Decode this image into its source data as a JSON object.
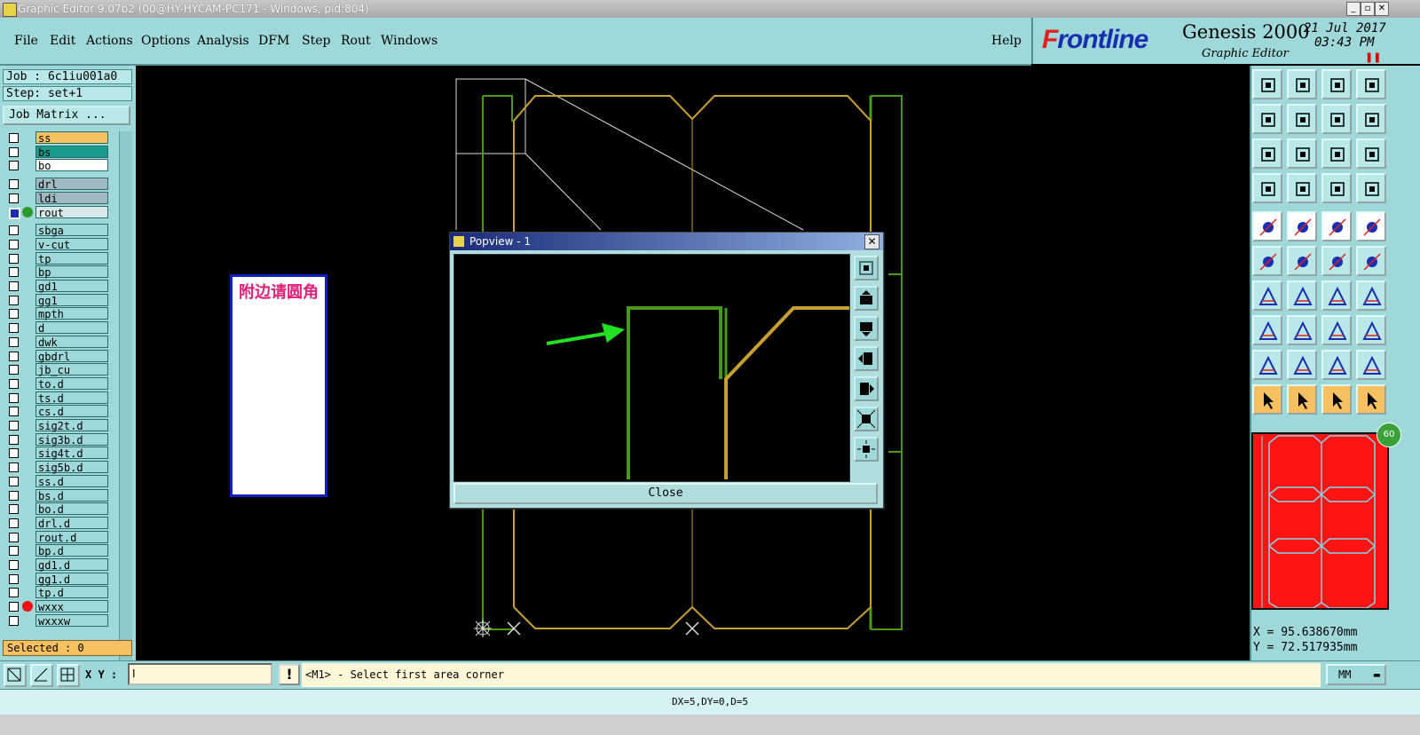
{
  "window": {
    "title": "Graphic Editor 9.07b2 (00@HY-HYCAM-PC171 - Windows, pid:804)"
  },
  "menu": [
    {
      "label": "File"
    },
    {
      "label": "Edit"
    },
    {
      "label": "Actions"
    },
    {
      "label": "Options"
    },
    {
      "label": "Analysis"
    },
    {
      "label": "DFM"
    },
    {
      "label": "Step"
    },
    {
      "label": "Rout"
    },
    {
      "label": "Windows"
    }
  ],
  "help_label": "Help",
  "brand": {
    "logo_prefix": "F",
    "logo_rest": "rontline",
    "product": "Genesis 2000",
    "subtitle": "Graphic Editor",
    "date": "21 Jul 2017",
    "time": "03:43 PM"
  },
  "job": {
    "job_label": "Job : 6c1iu001a0",
    "step_label": "Step: set+1",
    "matrix_button": "Job Matrix ..."
  },
  "layers": [
    {
      "name": "ss",
      "color": "#f7c060"
    },
    {
      "name": "bs",
      "color": "#1a9a8a"
    },
    {
      "name": "bo",
      "color": "#ffffff"
    },
    {
      "name": "drl",
      "color": "#a0b8c0"
    },
    {
      "name": "ldi",
      "color": "#a0b8c0"
    },
    {
      "name": "rout",
      "color": "#d8e8e8",
      "marker": "#2a9a2a",
      "active": true
    },
    {
      "name": "sbga"
    },
    {
      "name": "v-cut"
    },
    {
      "name": "tp"
    },
    {
      "name": "bp"
    },
    {
      "name": "gd1"
    },
    {
      "name": "gg1"
    },
    {
      "name": "mpth"
    },
    {
      "name": "d"
    },
    {
      "name": "dwk"
    },
    {
      "name": "gbdrl"
    },
    {
      "name": "jb_cu"
    },
    {
      "name": "to.d"
    },
    {
      "name": "ts.d"
    },
    {
      "name": "cs.d"
    },
    {
      "name": "sig2t.d"
    },
    {
      "name": "sig3b.d"
    },
    {
      "name": "sig4t.d"
    },
    {
      "name": "sig5b.d"
    },
    {
      "name": "ss.d"
    },
    {
      "name": "bs.d"
    },
    {
      "name": "bo.d"
    },
    {
      "name": "drl.d"
    },
    {
      "name": "rout.d"
    },
    {
      "name": "bp.d"
    },
    {
      "name": "gd1.d"
    },
    {
      "name": "gg1.d"
    },
    {
      "name": "tp.d"
    },
    {
      "name": "wxxx",
      "marker": "#ee1010"
    },
    {
      "name": "wxxxw"
    }
  ],
  "selected_label": "Selected : 0",
  "note": {
    "text": "附边请圆角"
  },
  "popview": {
    "title": "Popview - 1",
    "close_label": "Close"
  },
  "badge": "60",
  "coords": {
    "x": "X =  95.638670mm",
    "y": "Y =  72.517935mm"
  },
  "input": {
    "xy_label": "X Y :",
    "xy_value": "I",
    "warn": "!"
  },
  "prompt": "<M1> - Select first area corner",
  "units": {
    "value": "MM",
    "arrow": "▬"
  },
  "status": "DX=5,DY=0,D=5",
  "colors": {
    "panel": "#9ed8d8",
    "rout_green": "#4a9a1a",
    "profile_gold": "#c8a030"
  },
  "icons": [
    "window-icon",
    "minimize-icon",
    "restore-icon",
    "close-icon"
  ]
}
